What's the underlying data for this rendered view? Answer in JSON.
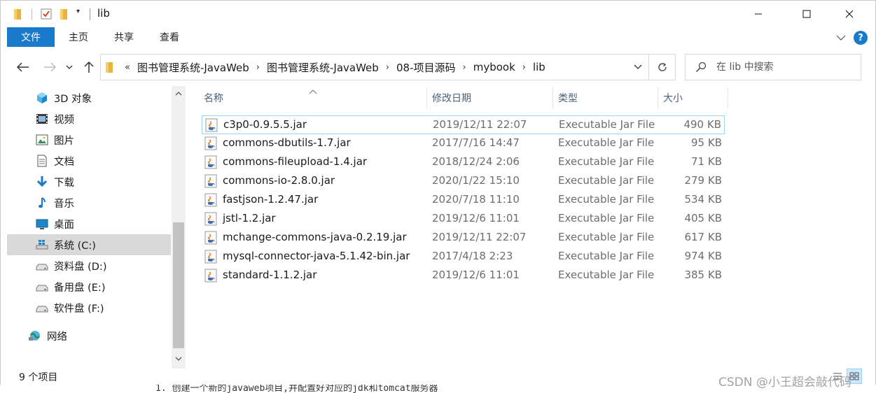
{
  "window": {
    "title": "lib"
  },
  "ribbon": {
    "tabs": [
      "文件",
      "主页",
      "共享",
      "查看"
    ],
    "help_label": "?"
  },
  "address": {
    "overflow_label": "«",
    "crumbs": [
      "图书管理系统-JavaWeb",
      "图书管理系统-JavaWeb",
      "08-项目源码",
      "mybook",
      "lib"
    ],
    "search_placeholder": "在 lib 中搜索"
  },
  "sidebar": {
    "items": [
      {
        "label": "3D 对象",
        "icon": "3d-objects-icon"
      },
      {
        "label": "视频",
        "icon": "videos-icon"
      },
      {
        "label": "图片",
        "icon": "pictures-icon"
      },
      {
        "label": "文档",
        "icon": "documents-icon"
      },
      {
        "label": "下载",
        "icon": "downloads-icon"
      },
      {
        "label": "音乐",
        "icon": "music-icon"
      },
      {
        "label": "桌面",
        "icon": "desktop-icon"
      },
      {
        "label": "系统 (C:)",
        "icon": "system-drive-icon",
        "selected": true
      },
      {
        "label": "资料盘 (D:)",
        "icon": "drive-icon"
      },
      {
        "label": "备用盘 (E:)",
        "icon": "drive-icon"
      },
      {
        "label": "软件盘 (F:)",
        "icon": "drive-icon"
      },
      {
        "label": "网络",
        "icon": "network-icon"
      }
    ]
  },
  "filelist": {
    "columns": [
      "名称",
      "修改日期",
      "类型",
      "大小"
    ],
    "files": [
      {
        "name": "c3p0-0.9.5.5.jar",
        "date": "2019/12/11 22:07",
        "type": "Executable Jar File",
        "size": "490 KB"
      },
      {
        "name": "commons-dbutils-1.7.jar",
        "date": "2017/7/16 14:47",
        "type": "Executable Jar File",
        "size": "95 KB"
      },
      {
        "name": "commons-fileupload-1.4.jar",
        "date": "2018/12/24 2:06",
        "type": "Executable Jar File",
        "size": "71 KB"
      },
      {
        "name": "commons-io-2.8.0.jar",
        "date": "2020/1/22 15:10",
        "type": "Executable Jar File",
        "size": "279 KB"
      },
      {
        "name": "fastjson-1.2.47.jar",
        "date": "2020/7/18 11:10",
        "type": "Executable Jar File",
        "size": "534 KB"
      },
      {
        "name": "jstl-1.2.jar",
        "date": "2019/12/6 11:01",
        "type": "Executable Jar File",
        "size": "405 KB"
      },
      {
        "name": "mchange-commons-java-0.2.19.jar",
        "date": "2019/12/11 22:07",
        "type": "Executable Jar File",
        "size": "617 KB"
      },
      {
        "name": "mysql-connector-java-5.1.42-bin.jar",
        "date": "2017/4/18 2:23",
        "type": "Executable Jar File",
        "size": "974 KB"
      },
      {
        "name": "standard-1.1.2.jar",
        "date": "2019/12/6 11:01",
        "type": "Executable Jar File",
        "size": "385 KB"
      }
    ]
  },
  "status": {
    "item_count": "9 个项目"
  },
  "background_text": "1. 创建一个新的javaweb项目,并配置好对应的jdk和tomcat服务器",
  "watermark": "CSDN @小王超会敲代码",
  "colors": {
    "accent": "#1979ca",
    "selection_border": "#99d1ff",
    "sidebar_selected": "#d9d9d9"
  }
}
